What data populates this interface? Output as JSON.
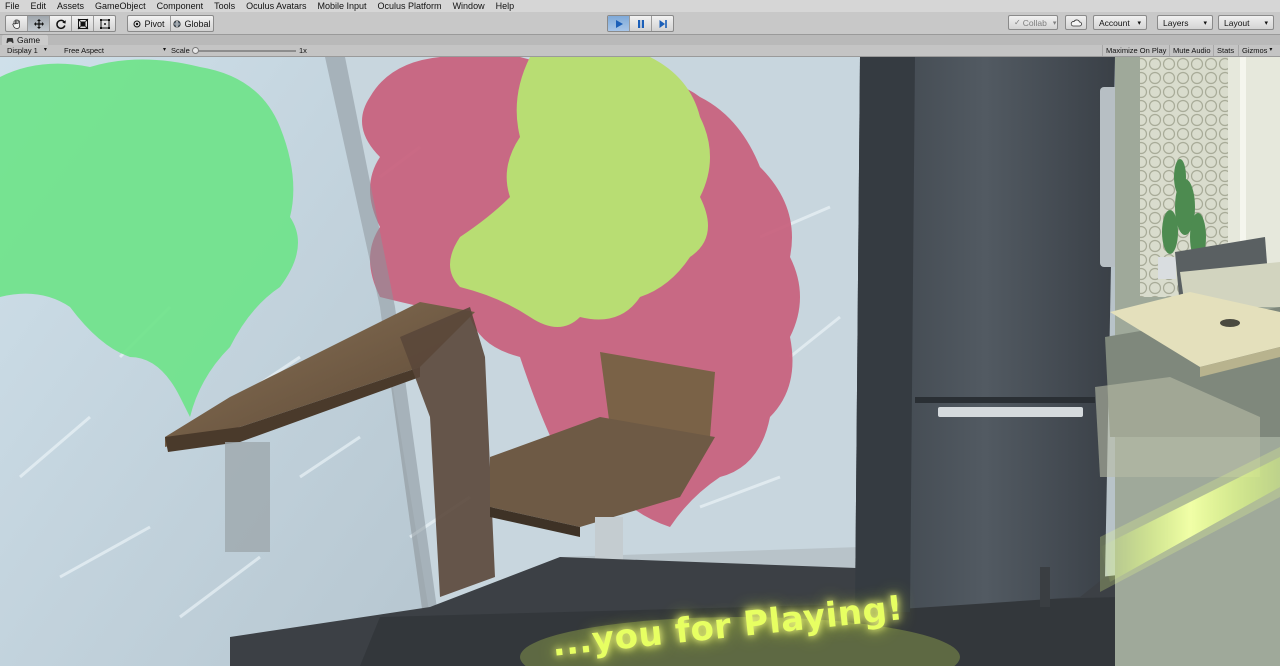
{
  "menubar": {
    "items": [
      "File",
      "Edit",
      "Assets",
      "GameObject",
      "Component",
      "Tools",
      "Oculus Avatars",
      "Mobile Input",
      "Oculus Platform",
      "Window",
      "Help"
    ]
  },
  "toolbar": {
    "tools": [
      {
        "name": "hand-tool",
        "icon": "hand-icon",
        "active": false
      },
      {
        "name": "move-tool",
        "icon": "move-arrows-icon",
        "active": true
      },
      {
        "name": "rotate-tool",
        "icon": "rotate-icon",
        "active": false
      },
      {
        "name": "scale-tool",
        "icon": "scale-icon",
        "active": false
      },
      {
        "name": "rect-tool",
        "icon": "rect-transform-icon",
        "active": false
      }
    ],
    "pivot_label": "Pivot",
    "global_label": "Global",
    "play_state": "playing",
    "collab_label": "Collab",
    "account_label": "Account",
    "layers_label": "Layers",
    "layout_label": "Layout"
  },
  "game_tab": {
    "title": "Game",
    "icon": "game-controller-icon",
    "display": "Display 1",
    "aspect": "Free Aspect",
    "scale_label": "Scale",
    "scale_value": "1x",
    "maximize_on_play": "Maximize On Play",
    "mute_audio": "Mute Audio",
    "stats": "Stats",
    "gizmos": "Gizmos"
  },
  "scene": {
    "end_message": "...you for Playing!",
    "colors": {
      "wall": "#c7d4dc",
      "paint_green": "#6fe38a",
      "paint_pink": "#c8637e",
      "paint_lime": "#b8dd73",
      "wood": "#6e5a45",
      "fridge": "#4a5158",
      "glow": "#e7ff62"
    }
  }
}
